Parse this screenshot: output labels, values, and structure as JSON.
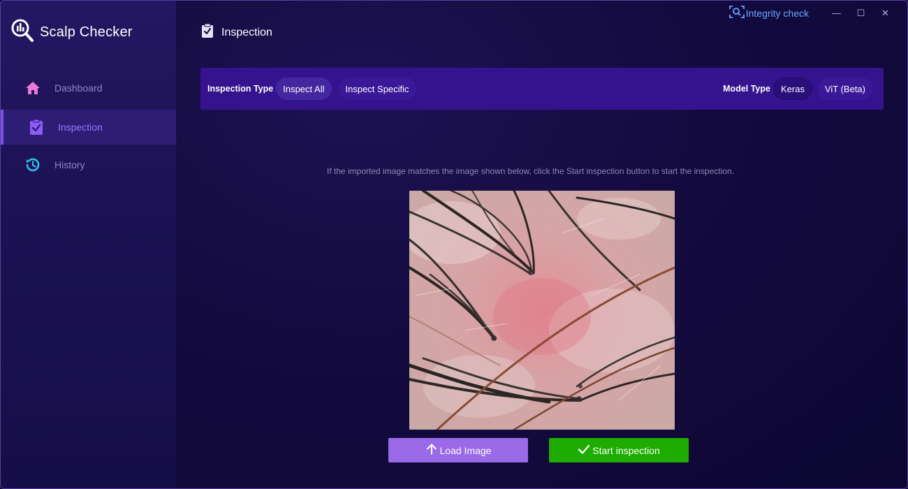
{
  "app": {
    "title": "Scalp Checker"
  },
  "sidebar": {
    "items": [
      {
        "label": "Dashboard",
        "icon": "home-icon",
        "active": false
      },
      {
        "label": "Inspection",
        "icon": "clipboard-check-icon",
        "active": true
      },
      {
        "label": "History",
        "icon": "history-icon",
        "active": false
      }
    ]
  },
  "titlebar": {
    "integrity_label": "Integrity check",
    "minimize": "—",
    "maximize": "☐",
    "close": "✕"
  },
  "page": {
    "title": "Inspection"
  },
  "toolbar": {
    "inspection_type_label": "Inspection Type",
    "inspection_options": [
      "Inspect All",
      "Inspect Specific"
    ],
    "inspection_selected": "Inspect All",
    "model_type_label": "Model Type",
    "model_options": [
      "Keras",
      "ViT (Beta)"
    ],
    "model_selected": "Keras"
  },
  "main": {
    "hint": "If the imported image matches the image shown below, click the Start inspection button to start the inspection.",
    "preview_description": "scalp-microscope-image",
    "load_button": "Load Image",
    "start_button": "Start inspection"
  },
  "colors": {
    "accent": "#7b52e8",
    "toolbar_bg": "#35138f",
    "load_button": "#9b6ae8",
    "start_button": "#1eac00",
    "integrity": "#6aa6ff",
    "home_icon": "#e87ad8",
    "history_icon": "#2fc3e8"
  }
}
